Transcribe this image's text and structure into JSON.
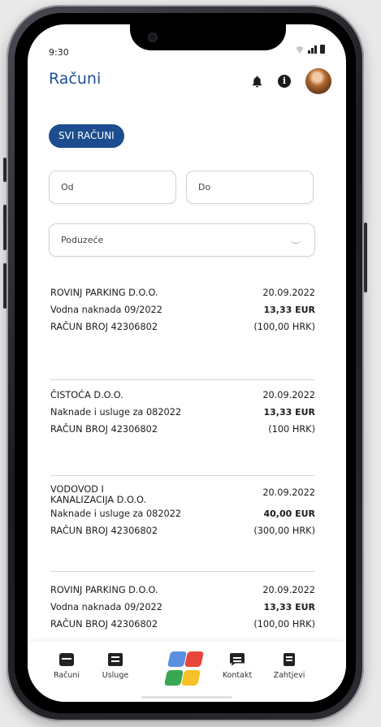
{
  "status_bar": {
    "time": "9:30"
  },
  "header": {
    "title": "Računi"
  },
  "filters": {
    "chip_label": "SVI RAČUNI",
    "from_placeholder": "Od",
    "to_placeholder": "Do",
    "company_placeholder": "Poduzeće"
  },
  "bills": [
    {
      "company": "ROVINJ PARKING D.O.O.",
      "description": "Vodna naknada 09/2022",
      "number": "RAČUN BROJ 42306802",
      "date": "20.09.2022",
      "amount_eur": "13,33 EUR",
      "amount_hrk": "(100,00 HRK)"
    },
    {
      "company": "ČISTOĆA D.O.O.",
      "description": "Naknade i usluge za 082022",
      "number": "RAČUN BROJ 42306802",
      "date": "20.09.2022",
      "amount_eur": "13,33 EUR",
      "amount_hrk": "(100 HRK)"
    },
    {
      "company_line1": "VODOVOD I",
      "company_line2": "KANALIZACIJA D.O.O.",
      "description": "Naknade i usluge za 082022",
      "number": "RAČUN BROJ 42306802",
      "date": "20.09.2022",
      "amount_eur": "40,00 EUR",
      "amount_hrk": "(300,00 HRK)"
    },
    {
      "company": "ROVINJ PARKING D.O.O.",
      "description": "Vodna naknada 09/2022",
      "number": "RAČUN BROJ 42306802",
      "date": "20.09.2022",
      "amount_eur": "13,33 EUR",
      "amount_hrk": "(100,00 HRK)"
    }
  ],
  "nav": {
    "racuni": "Računi",
    "usluge": "Usluge",
    "kontakt": "Kontakt",
    "zahtjevi": "Zahtjevi"
  },
  "colors": {
    "accent": "#1f4f9a",
    "chip": "#1b4d8f",
    "logo_blue": "#5b8fe0",
    "logo_red": "#e8453c",
    "logo_green": "#3aa853",
    "logo_yellow": "#f6c026"
  }
}
